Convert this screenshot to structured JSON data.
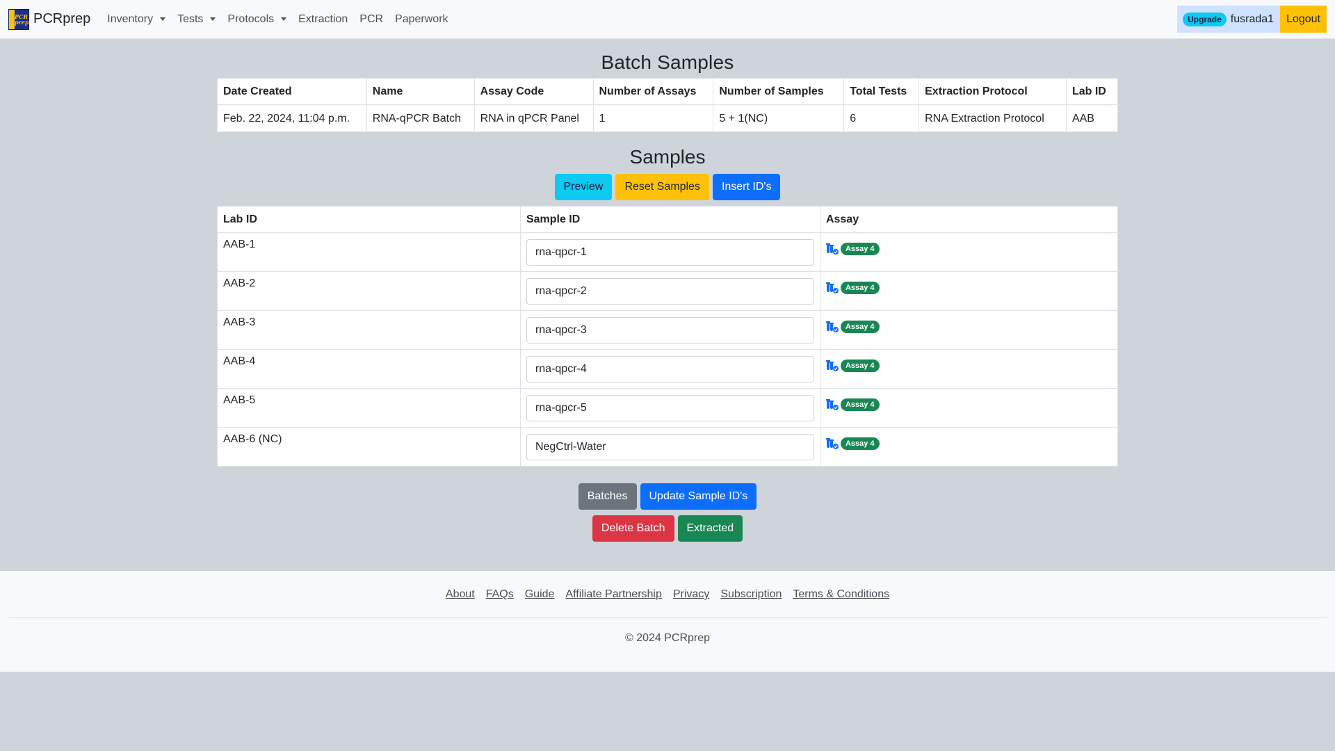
{
  "navbar": {
    "brand": "PCRprep",
    "logo_text": "PCR prep",
    "menu": [
      {
        "label": "Inventory",
        "dropdown": true
      },
      {
        "label": "Tests",
        "dropdown": true
      },
      {
        "label": "Protocols",
        "dropdown": true
      },
      {
        "label": "Extraction",
        "dropdown": false
      },
      {
        "label": "PCR",
        "dropdown": false
      },
      {
        "label": "Paperwork",
        "dropdown": false
      }
    ],
    "upgrade_badge": "Upgrade",
    "username": "fusrada1",
    "logout": "Logout"
  },
  "batch": {
    "title": "Batch Samples",
    "headers": [
      "Date Created",
      "Name",
      "Assay Code",
      "Number of Assays",
      "Number of Samples",
      "Total Tests",
      "Extraction Protocol",
      "Lab ID"
    ],
    "row": [
      "Feb. 22, 2024, 11:04 p.m.",
      "RNA-qPCR Batch",
      "RNA in qPCR Panel",
      "1",
      "5 + 1(NC)",
      "6",
      "RNA Extraction Protocol",
      "AAB"
    ]
  },
  "samples": {
    "title": "Samples",
    "buttons": {
      "preview": "Preview",
      "reset": "Reset Samples",
      "insert": "Insert ID's"
    },
    "headers": [
      "Lab ID",
      "Sample ID",
      "Assay"
    ],
    "rows": [
      {
        "lab_id": "AAB-1",
        "sample_id": "rna-qpcr-1",
        "assay": "Assay 4"
      },
      {
        "lab_id": "AAB-2",
        "sample_id": "rna-qpcr-2",
        "assay": "Assay 4"
      },
      {
        "lab_id": "AAB-3",
        "sample_id": "rna-qpcr-3",
        "assay": "Assay 4"
      },
      {
        "lab_id": "AAB-4",
        "sample_id": "rna-qpcr-4",
        "assay": "Assay 4"
      },
      {
        "lab_id": "AAB-5",
        "sample_id": "rna-qpcr-5",
        "assay": "Assay 4"
      },
      {
        "lab_id": "AAB-6 (NC)",
        "sample_id": "NegCtrl-Water",
        "assay": "Assay 4"
      }
    ]
  },
  "actions": {
    "batches": "Batches",
    "update": "Update Sample ID's",
    "delete": "Delete Batch",
    "extracted": "Extracted"
  },
  "footer": {
    "links": [
      "About",
      "FAQs",
      "Guide",
      "Affiliate Partnership",
      "Privacy",
      "Subscription",
      "Terms & Conditions"
    ],
    "copyright": "© 2024 PCRprep"
  },
  "colors": {
    "background": "#ced4da",
    "primary": "#0d6efd",
    "info": "#0dcaf0",
    "warning": "#ffc107",
    "secondary": "#6c757d",
    "danger": "#dc3545",
    "success": "#198754"
  }
}
